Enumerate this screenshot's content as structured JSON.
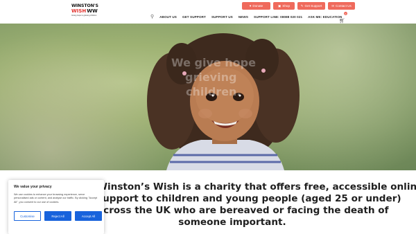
{
  "logo": {
    "line1": "WINSTON'S",
    "line2": "WISH",
    "mark": "WW",
    "tagline": "Giving hope to grieving children"
  },
  "top_buttons": [
    {
      "label": "Donate",
      "icon": "heart-hand-icon"
    },
    {
      "label": "Shop",
      "icon": "bag-icon"
    },
    {
      "label": "Get Support",
      "icon": "support-icon"
    },
    {
      "label": "Contact Us",
      "icon": "mail-icon"
    }
  ],
  "nav": {
    "items": [
      "ABOUT US",
      "GET SUPPORT",
      "SUPPORT US",
      "NEWS",
      "SUPPORT LINE: 08088 020 021",
      "ASK ME: EDUCATION"
    ],
    "cart_count": "0"
  },
  "hero": {
    "line1": "We give hope",
    "line2": "grieving",
    "line3": "children."
  },
  "mission": {
    "line1": "Winston’s Wish is a charity that offers free, accessible online",
    "line2": "support to children and young people (aged 25 or under)",
    "line3": "across the UK who are bereaved or facing the death of",
    "line4": "someone important."
  },
  "cookie": {
    "title": "We value your privacy",
    "text": "We use cookies to enhance your browsing experience, serve personalised ads or content, and analyse our traffic. By clicking \"Accept All\", you consent to our use of cookies.",
    "customise": "Customise",
    "reject": "Reject All",
    "accept": "Accept All"
  },
  "colors": {
    "accent": "#ef6a5c",
    "cookie_blue": "#1863dc",
    "brand_red": "#e2322e"
  }
}
